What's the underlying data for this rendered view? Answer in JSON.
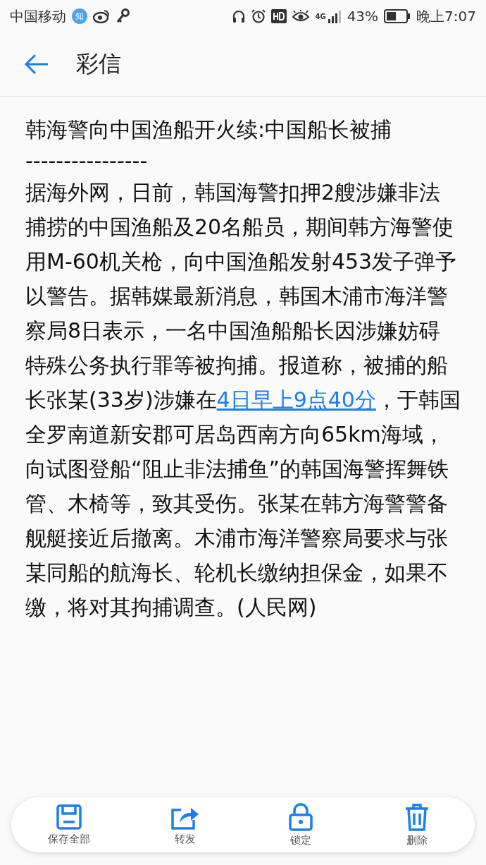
{
  "status_bar": {
    "carrier": "中国移动",
    "app_badge": "知",
    "network": "4G",
    "battery_percent": "43%",
    "time": "晚上7:07"
  },
  "header": {
    "title": "彩信"
  },
  "message": {
    "headline": "韩海警向中国渔船开火续:中国船长被捕",
    "separator": "----------------",
    "body_before": "据海外网，日前，韩国海警扣押2艘涉嫌非法捕捞的中国渔船及20名船员，期间韩方海警使用M-60机关枪，向中国渔船发射453发子弹予以警告。据韩媒最新消息，韩国木浦市海洋警察局8日表示，一名中国渔船船长因涉嫌妨碍特殊公务执行罪等被拘捕。报道称，被捕的船长张某(33岁)涉嫌在",
    "link": "4日早上9点40分",
    "body_after": "，于韩国全罗南道新安郡可居岛西南方向65km海域，向试图登船“阻止非法捕鱼”的韩国海警挥舞铁管、木椅等，致其受伤。张某在韩方海警警备舰艇接近后撤离。木浦市海洋警察局要求与张某同船的航海长、轮机长缴纳担保金，如果不缴，将对其拘捕调查。(人民网)"
  },
  "actions": [
    {
      "kind": "save",
      "label": "保存全部"
    },
    {
      "kind": "forward",
      "label": "转发"
    },
    {
      "kind": "lock",
      "label": "锁定"
    },
    {
      "kind": "delete",
      "label": "删除"
    }
  ]
}
